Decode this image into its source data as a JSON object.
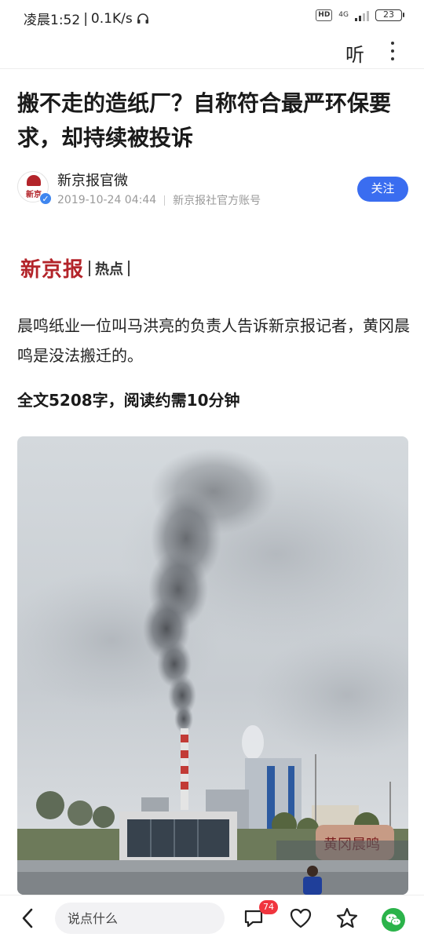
{
  "status_bar": {
    "time": "凌晨1:52",
    "speed": "0.1K/s",
    "network": "4G",
    "hd": "HD",
    "battery": "23"
  },
  "toolbar": {
    "listen_label": "听",
    "more_icon": "more-vertical-icon"
  },
  "article": {
    "title": "搬不走的造纸厂？自称符合最严环保要求，却持续被投诉",
    "author": {
      "name": "新京报官微",
      "avatar_text": "新京",
      "date": "2019-10-24 04:44",
      "account_type": "新京报社官方账号",
      "follow_label": "关注"
    },
    "banner": {
      "brand": "新京报",
      "section": "热点"
    },
    "lede": "晨鸣纸业一位叫马洪亮的负责人告诉新京报记者，黄冈晨鸣是没法搬迁的。",
    "read_time": "全文5208字，阅读约需10分钟",
    "photo": {
      "gate_sign": "黄冈晨鸣"
    }
  },
  "bottom_bar": {
    "comment_placeholder": "说点什么",
    "comment_count": "74",
    "icons": [
      "back-icon",
      "comment-icon",
      "like-icon",
      "favorite-icon",
      "wechat-share-icon"
    ]
  },
  "colors": {
    "accent_blue": "#3a6df0",
    "brand_red": "#b3242a",
    "badge_red": "#f0353e",
    "wechat_green": "#2bb34a"
  }
}
